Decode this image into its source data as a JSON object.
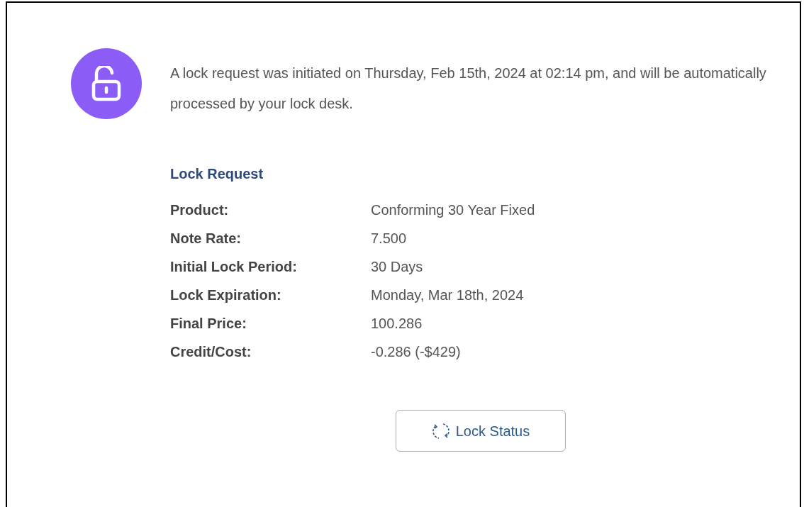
{
  "message": "A lock request was initiated on Thursday, Feb 15th, 2024 at 02:14 pm, and will be automatically processed by your lock desk.",
  "section_title": "Lock Request",
  "details": [
    {
      "label": "Product:",
      "value": "Conforming 30 Year Fixed"
    },
    {
      "label": "Note Rate:",
      "value": "7.500"
    },
    {
      "label": "Initial Lock Period:",
      "value": "30 Days"
    },
    {
      "label": "Lock Expiration:",
      "value": "Monday, Mar 18th, 2024"
    },
    {
      "label": "Final Price:",
      "value": "100.286"
    },
    {
      "label": "Credit/Cost:",
      "value": "-0.286 (-$429)"
    }
  ],
  "button": "Lock Status"
}
